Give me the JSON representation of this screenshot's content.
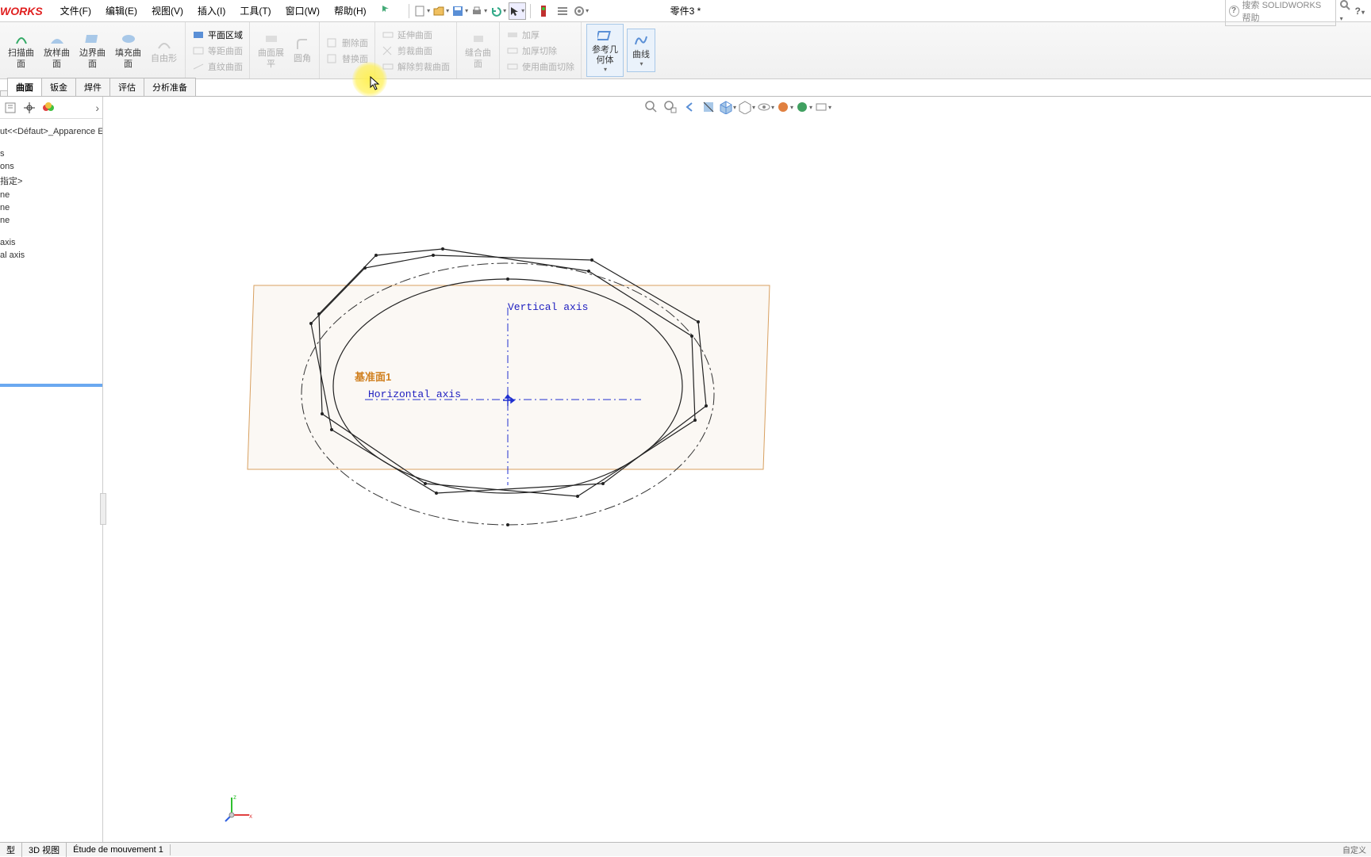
{
  "app": {
    "logo": "WORKS",
    "doc_title": "零件3 *"
  },
  "menu": {
    "file": "文件(F)",
    "edit": "编辑(E)",
    "view": "视图(V)",
    "insert": "插入(I)",
    "tools": "工具(T)",
    "window": "窗口(W)",
    "help": "帮助(H)"
  },
  "search": {
    "placeholder": "搜索 SOLIDWORKS 帮助"
  },
  "ribbon": {
    "swept": "扫描曲\n面",
    "lofted": "放样曲\n面",
    "boundary": "边界曲\n面",
    "filled": "填充曲\n面",
    "freeform": "自由形",
    "planar": "平面区域",
    "offset": "等距曲面",
    "ruled": "直纹曲面",
    "flatten": "曲面展\n平",
    "fillet": "圆角",
    "delete": "删除面",
    "extend": "延伸曲面",
    "trim": "剪裁曲面",
    "replace": "替换面",
    "untrim": "解除剪裁曲面",
    "knit": "缝合曲\n面",
    "thicken": "加厚",
    "thicken_cut": "加厚切除",
    "cut_with": "使用曲面切除",
    "ref_geom": "参考几\n何体",
    "curves": "曲线"
  },
  "tabs": {
    "surfaces": "曲面",
    "sheet": "钣金",
    "weld": "焊件",
    "eval": "评估",
    "prep": "分析准备"
  },
  "tree": {
    "config": "ut<<Défaut>_Apparence Et",
    "i1": "s",
    "i2": "ons",
    "i3": "指定>",
    "i4": "ne",
    "i5": "ne",
    "i6": "ne",
    "i7": "axis",
    "i8": "al axis"
  },
  "viewport": {
    "plane_label": "基准面1",
    "v_axis": "Vertical axis",
    "h_axis": "Horizontal axis"
  },
  "bottom": {
    "model": "型",
    "view3d": "3D 视图",
    "motion": "Étude de mouvement 1",
    "status": "自定义"
  }
}
